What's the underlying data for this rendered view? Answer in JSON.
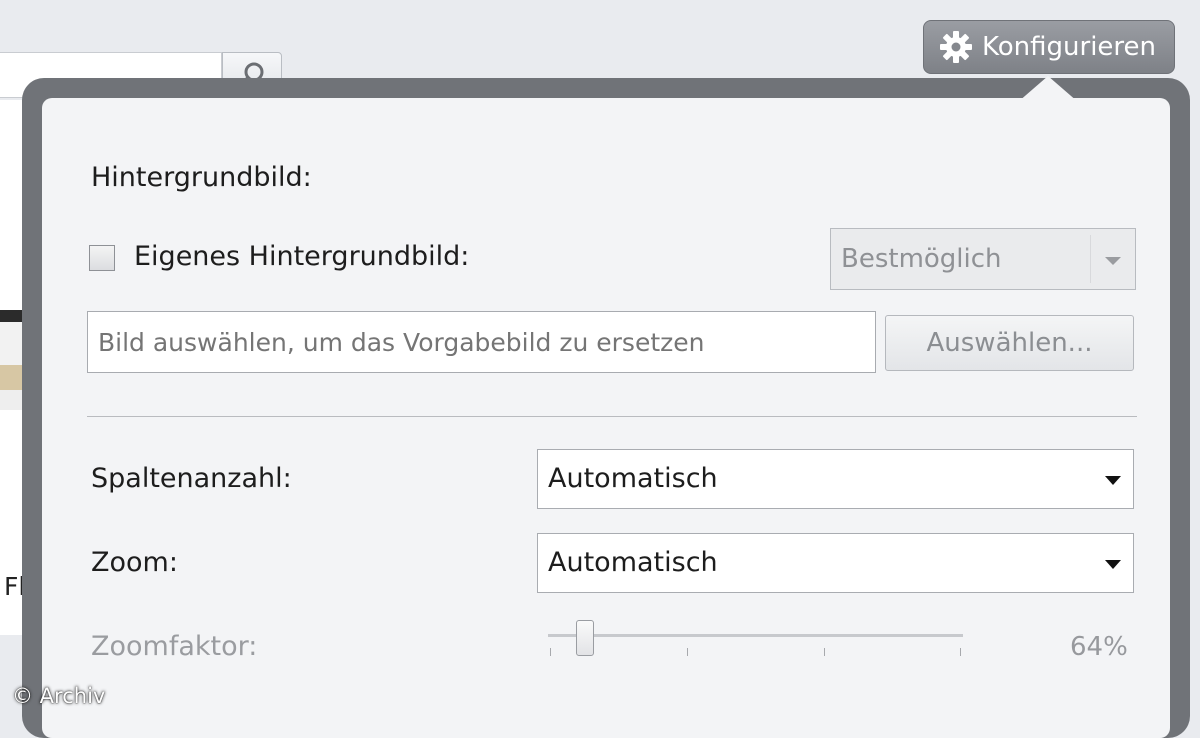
{
  "header": {
    "configure_button_label": "Konfigurieren"
  },
  "background": {
    "thumbnail_label": "Fl...",
    "watermark": "© Archiv"
  },
  "popup": {
    "section_title": "Hintergrundbild:",
    "custom_background": {
      "label": "Eigenes Hintergrundbild:",
      "checked": false,
      "fit_select_value": "Bestmöglich"
    },
    "image_input": {
      "placeholder": "Bild auswählen, um das Vorgabebild zu ersetzen",
      "value": ""
    },
    "choose_button_label": "Auswählen...",
    "columns": {
      "label": "Spaltenanzahl:",
      "value": "Automatisch"
    },
    "zoom": {
      "label": "Zoom:",
      "value": "Automatisch"
    },
    "zoom_factor": {
      "label": "Zoomfaktor:",
      "value_text": "64%",
      "value": 64,
      "disabled": true
    }
  },
  "colors": {
    "frame": "#707378",
    "panel": "#f3f4f6",
    "configure_button": "#8a8d93"
  },
  "icons": {
    "configure": "gear-icon",
    "search": "search-icon"
  }
}
